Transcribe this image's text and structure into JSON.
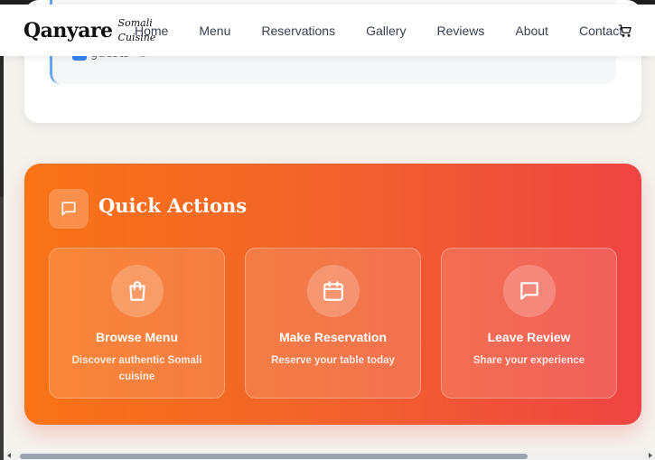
{
  "brand": {
    "name": "Qanyare",
    "tagline": "Somali Cuisine"
  },
  "nav": {
    "items": [
      "Home",
      "Menu",
      "Reservations",
      "Gallery",
      "Reviews",
      "About",
      "Contact"
    ],
    "cart_icon": "cart-icon"
  },
  "reservation_preview": {
    "guests_label": "guests",
    "guests_icon": "users-icon",
    "extra_icon": "utensils-icon"
  },
  "quick_actions": {
    "title": "Quick Actions",
    "icon": "message-square-icon",
    "gradient": [
      "#f97316",
      "#ef4444"
    ],
    "cards": [
      {
        "icon": "shopping-bag-icon",
        "title": "Browse Menu",
        "description": "Discover authentic Somali cuisine"
      },
      {
        "icon": "calendar-icon",
        "title": "Make Reservation",
        "description": "Reserve your table today"
      },
      {
        "icon": "message-square-icon",
        "title": "Leave Review",
        "description": "Share your experience"
      }
    ]
  }
}
